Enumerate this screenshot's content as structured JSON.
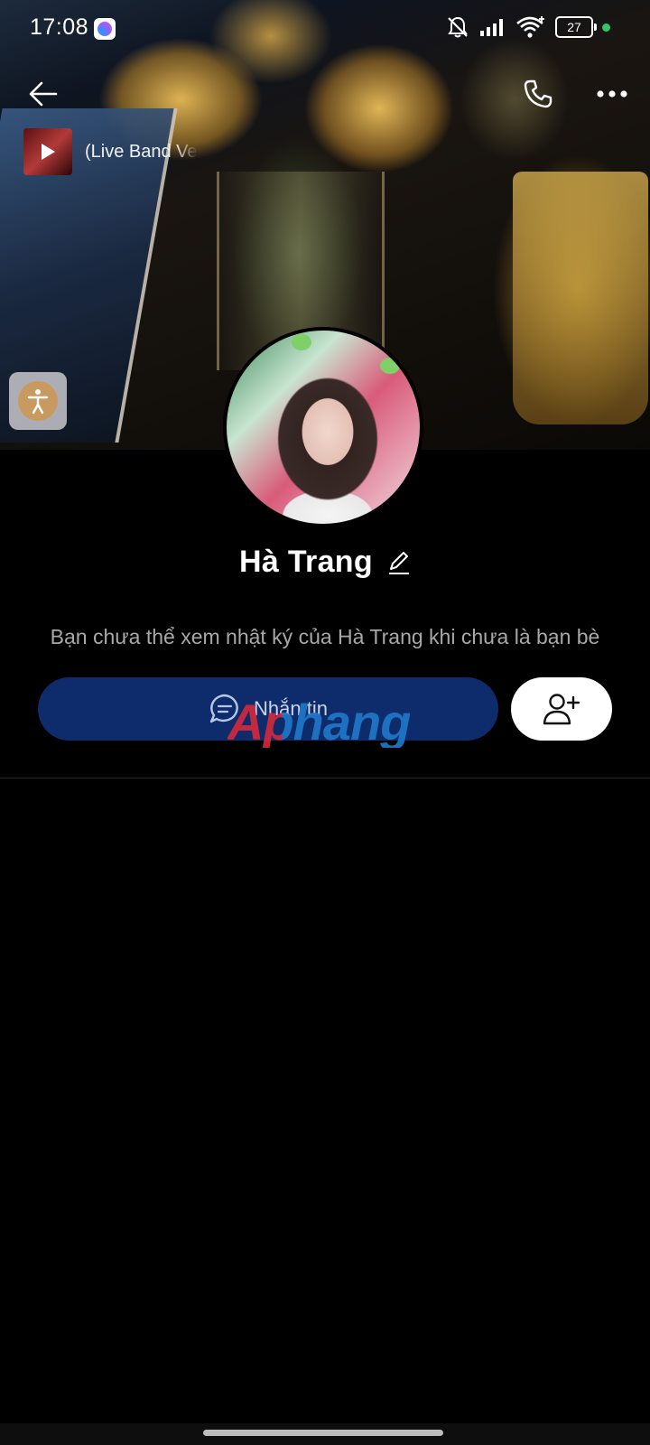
{
  "status_bar": {
    "time": "17:08",
    "notification_app": "messenger-icon",
    "battery_level": "27",
    "icons": [
      "mute-icon",
      "signal-icon",
      "wifi-icon",
      "battery-icon"
    ]
  },
  "header": {
    "back_icon": "arrow-left-icon",
    "call_icon": "phone-icon",
    "more_icon": "more-horizontal-icon"
  },
  "music": {
    "title": "(Live Band Ve"
  },
  "profile": {
    "name": "Hà Trang",
    "notice": "Bạn chưa thể xem nhật ký của Hà Trang khi chưa là bạn bè"
  },
  "actions": {
    "message_label": "Nhắn tin",
    "add_friend_icon": "user-plus-icon"
  },
  "watermark": {
    "text": "Aphang"
  },
  "colors": {
    "message_button_bg": "#0e2b6b",
    "add_friend_bg": "#ffffff",
    "background": "#000000",
    "notice_text": "#a8a8a8"
  }
}
